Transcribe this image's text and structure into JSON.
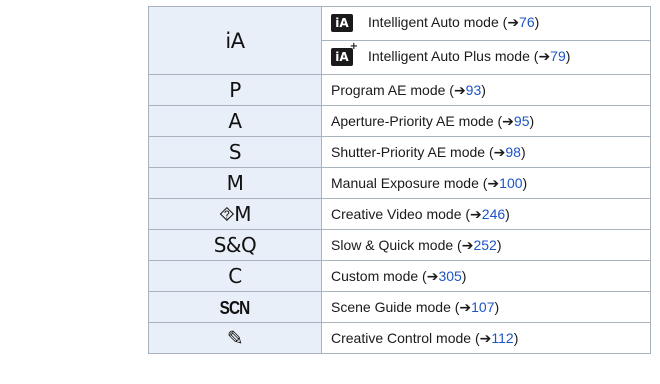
{
  "rows": [
    {
      "mode": "iA",
      "desc": "Intelligent Auto mode (",
      "page": "76",
      "badge": "iA"
    },
    {
      "desc": "Intelligent Auto Plus mode (",
      "page": "79",
      "badge": "iA",
      "badge_plus": "+"
    },
    {
      "mode": "P",
      "desc": "Program AE mode (",
      "page": "93"
    },
    {
      "mode": "A",
      "desc": "Aperture-Priority AE mode (",
      "page": "95"
    },
    {
      "mode": "S",
      "desc": "Shutter-Priority AE mode (",
      "page": "98"
    },
    {
      "mode": "M",
      "desc": "Manual Exposure mode (",
      "page": "100"
    },
    {
      "mode": "⯑M",
      "desc": "Creative Video mode (",
      "page": "246"
    },
    {
      "mode": "S&Q",
      "desc": "Slow & Quick mode (",
      "page": "252"
    },
    {
      "mode": "C",
      "desc": "Custom mode (",
      "page": "305"
    },
    {
      "mode": "SCN",
      "desc": "Scene Guide mode (",
      "page": "107"
    },
    {
      "mode": "✎",
      "desc": "Creative Control mode (",
      "page": "112"
    }
  ],
  "arrow": "➔",
  "close": ")",
  "colors": {
    "mode_cell_bg": "#e9eff8",
    "border": "#a9b3bf",
    "link": "#1c55c7"
  }
}
